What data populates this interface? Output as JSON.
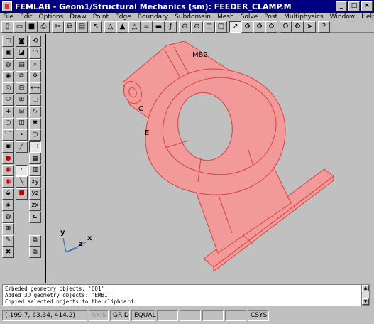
{
  "window": {
    "app_name": "FEMLAB",
    "title": "FEMLAB - Geom1/Structural Mechanics (sm): FEEDER_CLAMP.M",
    "minimize": "_",
    "maximize": "□",
    "close": "×"
  },
  "menu": {
    "items": [
      "File",
      "Edit",
      "Options",
      "Draw",
      "Point",
      "Edge",
      "Boundary",
      "Subdomain",
      "Mesh",
      "Solve",
      "Post",
      "Multiphysics",
      "Window",
      "Help"
    ]
  },
  "toolbar": {
    "buttons": [
      {
        "name": "new-icon",
        "glyph": "▯"
      },
      {
        "name": "open-icon",
        "glyph": "▭"
      },
      {
        "name": "save-icon",
        "glyph": "■"
      },
      {
        "name": "print-icon",
        "glyph": "⎙"
      },
      {
        "name": "cut-icon",
        "glyph": "✂"
      },
      {
        "name": "copy-icon",
        "glyph": "⧉"
      },
      {
        "name": "paste-icon",
        "glyph": "▤"
      },
      {
        "name": "select-arrow-icon",
        "glyph": "↖"
      },
      {
        "name": "triangle-icon",
        "glyph": "△"
      },
      {
        "name": "mesh-refine-icon",
        "glyph": "▲"
      },
      {
        "name": "triangle-alt-icon",
        "glyph": "△"
      },
      {
        "name": "equals-icon",
        "glyph": "="
      },
      {
        "name": "solve-icon",
        "glyph": "▬"
      },
      {
        "name": "function-icon",
        "glyph": "ƒ"
      },
      {
        "name": "zoom-in-icon",
        "glyph": "⊕"
      },
      {
        "name": "zoom-out-icon",
        "glyph": "⊖"
      },
      {
        "name": "zoom-window-icon",
        "glyph": "⊡"
      },
      {
        "name": "zoom-extents-icon",
        "glyph": "◫"
      },
      {
        "name": "plot-icon",
        "glyph": "↗"
      },
      {
        "name": "subdomain-plot-icon",
        "glyph": "⚙"
      },
      {
        "name": "boundary-plot-icon",
        "glyph": "⚙"
      },
      {
        "name": "edge-plot-icon",
        "glyph": "⚙"
      },
      {
        "name": "omega-icon",
        "glyph": "Ω"
      },
      {
        "name": "settings-icon",
        "glyph": "⚙"
      },
      {
        "name": "postprocess-icon",
        "glyph": "➤"
      },
      {
        "name": "help-icon",
        "glyph": "?"
      }
    ]
  },
  "left_tools": [
    {
      "name": "box-icon",
      "glyph": "▢"
    },
    {
      "name": "cylinder-icon",
      "glyph": "◙"
    },
    {
      "name": "rotate-icon",
      "glyph": "⟲"
    },
    {
      "name": "block-shade-icon",
      "glyph": "▣"
    },
    {
      "name": "block-corner-icon",
      "glyph": "◪"
    },
    {
      "name": "arc-icon",
      "glyph": "◠"
    },
    {
      "name": "sphere-icon",
      "glyph": "◍"
    },
    {
      "name": "layers-icon",
      "glyph": "▤"
    },
    {
      "name": "zoom-icon",
      "glyph": "⌕"
    },
    {
      "name": "cone-icon",
      "glyph": "◉"
    },
    {
      "name": "stack-icon",
      "glyph": "⧉"
    },
    {
      "name": "move-icon",
      "glyph": "✥"
    },
    {
      "name": "torus-icon",
      "glyph": "◎"
    },
    {
      "name": "scale-icon",
      "glyph": "⊟"
    },
    {
      "name": "mirror-icon",
      "glyph": "⟷"
    },
    {
      "name": "ellipsoid-icon",
      "glyph": "⬭"
    },
    {
      "name": "array-icon",
      "glyph": "⊞"
    },
    {
      "name": "copy-object-icon",
      "glyph": "⬚"
    },
    {
      "name": "point-add-icon",
      "glyph": "+"
    },
    {
      "name": "point-remove-icon",
      "glyph": "⊟"
    },
    {
      "name": "spline-icon",
      "glyph": "∿"
    },
    {
      "name": "circle-icon",
      "glyph": "○"
    },
    {
      "name": "union-icon",
      "glyph": "◫"
    },
    {
      "name": "light-icon",
      "glyph": "✸"
    },
    {
      "name": "curve-icon",
      "glyph": "⌒"
    },
    {
      "name": "point-icon",
      "glyph": "•"
    },
    {
      "name": "view-iso-icon",
      "glyph": "⬡"
    },
    {
      "name": "cube-icon",
      "glyph": "▣"
    },
    {
      "name": "line-icon",
      "glyph": "╱"
    },
    {
      "name": "view-front-icon",
      "glyph": "▢"
    },
    {
      "name": "record-red-icon",
      "glyph": "●"
    },
    {
      "name": "",
      "glyph": ""
    },
    {
      "name": "grid-view-icon",
      "glyph": "▦"
    },
    {
      "name": "eye-red-icon",
      "glyph": "◉"
    },
    {
      "name": "point-mark-icon",
      "glyph": "·"
    },
    {
      "name": "panel-icon",
      "glyph": "▥"
    },
    {
      "name": "eye-red-alt-icon",
      "glyph": "◉"
    },
    {
      "name": "diagonal-icon",
      "glyph": "╲"
    },
    {
      "name": "view-xy-icon",
      "glyph": "xy"
    },
    {
      "name": "wire-icon",
      "glyph": "⬙"
    },
    {
      "name": "red-box-icon",
      "glyph": "■"
    },
    {
      "name": "view-yz-icon",
      "glyph": "yz"
    },
    {
      "name": "render-icon",
      "glyph": "◈"
    },
    {
      "name": "",
      "glyph": ""
    },
    {
      "name": "view-zx-icon",
      "glyph": "zx"
    },
    {
      "name": "globe-icon",
      "glyph": "◍"
    },
    {
      "name": "",
      "glyph": ""
    },
    {
      "name": "axis-icon",
      "glyph": "⊾"
    },
    {
      "name": "grid-icon",
      "glyph": "⊞"
    },
    {
      "name": "",
      "glyph": ""
    },
    {
      "name": "",
      "glyph": ""
    },
    {
      "name": "pencil-icon",
      "glyph": "✎"
    },
    {
      "name": "",
      "glyph": ""
    },
    {
      "name": "copy-view-icon",
      "glyph": "⧉"
    },
    {
      "name": "delete-icon",
      "glyph": "✖"
    },
    {
      "name": "",
      "glyph": ""
    },
    {
      "name": "paste-view-icon",
      "glyph": "⧉"
    }
  ],
  "canvas": {
    "labels": {
      "emb2": "MB2",
      "c01": "C",
      "e": "E"
    },
    "axes": {
      "y": "y",
      "z": "z",
      "x": "x"
    },
    "colors": {
      "solid_fill": "#f29a9a",
      "solid_edge": "#d94040",
      "background": "#c0c0c0",
      "axis": "#3a6ea5"
    }
  },
  "log": {
    "lines": [
      "Embeded geometry objects: 'CO1'",
      "Added 3D geometry objects: 'EMB1'",
      "Copied selected objects to the clipboard."
    ]
  },
  "status": {
    "coords": "(-199.7, 63.34, 414.2)",
    "axis": "AXIS",
    "grid": "GRID",
    "equal": "EQUAL",
    "csys": "CSYS"
  }
}
